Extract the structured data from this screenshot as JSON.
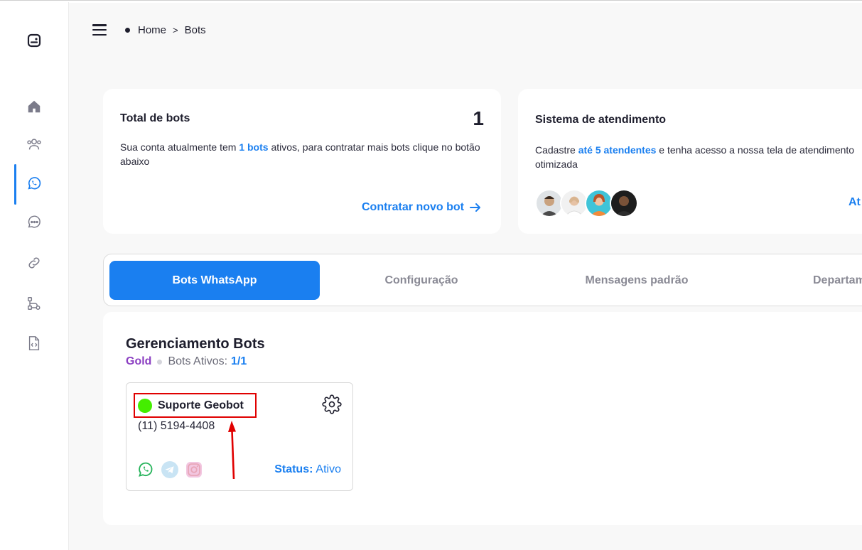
{
  "breadcrumb": {
    "home": "Home",
    "separator": ">",
    "current": "Bots"
  },
  "sidebar": {
    "items": [
      {
        "icon": "home-icon",
        "active": false
      },
      {
        "icon": "users-icon",
        "active": false
      },
      {
        "icon": "whatsapp-icon",
        "active": true
      },
      {
        "icon": "chat-icon",
        "active": false
      },
      {
        "icon": "link-icon",
        "active": false
      },
      {
        "icon": "flow-icon",
        "active": false
      },
      {
        "icon": "code-file-icon",
        "active": false
      }
    ]
  },
  "total_bots_card": {
    "title": "Total de bots",
    "count": "1",
    "text_before": "Sua conta atualmente tem ",
    "text_highlight": "1 bots",
    "text_after": " ativos, para contratar mais bots clique no botão abaixo",
    "cta": "Contratar novo bot"
  },
  "atendimento_card": {
    "title": "Sistema de atendimento",
    "text_before": "Cadastre ",
    "text_highlight": "até 5 atendentes",
    "text_after": " e tenha acesso a nossa tela de atendimento otimizada",
    "link": "At"
  },
  "tabs": [
    {
      "label": "Bots WhatsApp",
      "active": true
    },
    {
      "label": "Configuração",
      "active": false
    },
    {
      "label": "Mensagens padrão",
      "active": false
    },
    {
      "label": "Departamentos",
      "active": false
    }
  ],
  "panel": {
    "title": "Gerenciamento Bots",
    "plan": "Gold",
    "bots_active_label": "Bots Ativos:",
    "bots_active_value": "1/1"
  },
  "bot": {
    "name": "Suporte Geobot",
    "phone": "(11) 5194-4408",
    "status_label": "Status:",
    "status_value": "Ativo",
    "status_color": "#44ee00",
    "channels": [
      "whatsapp-icon",
      "telegram-icon",
      "instagram-icon"
    ]
  },
  "colors": {
    "accent": "#1a7ff0",
    "plan": "#8b3fc2",
    "highlight_box": "#e00000"
  }
}
